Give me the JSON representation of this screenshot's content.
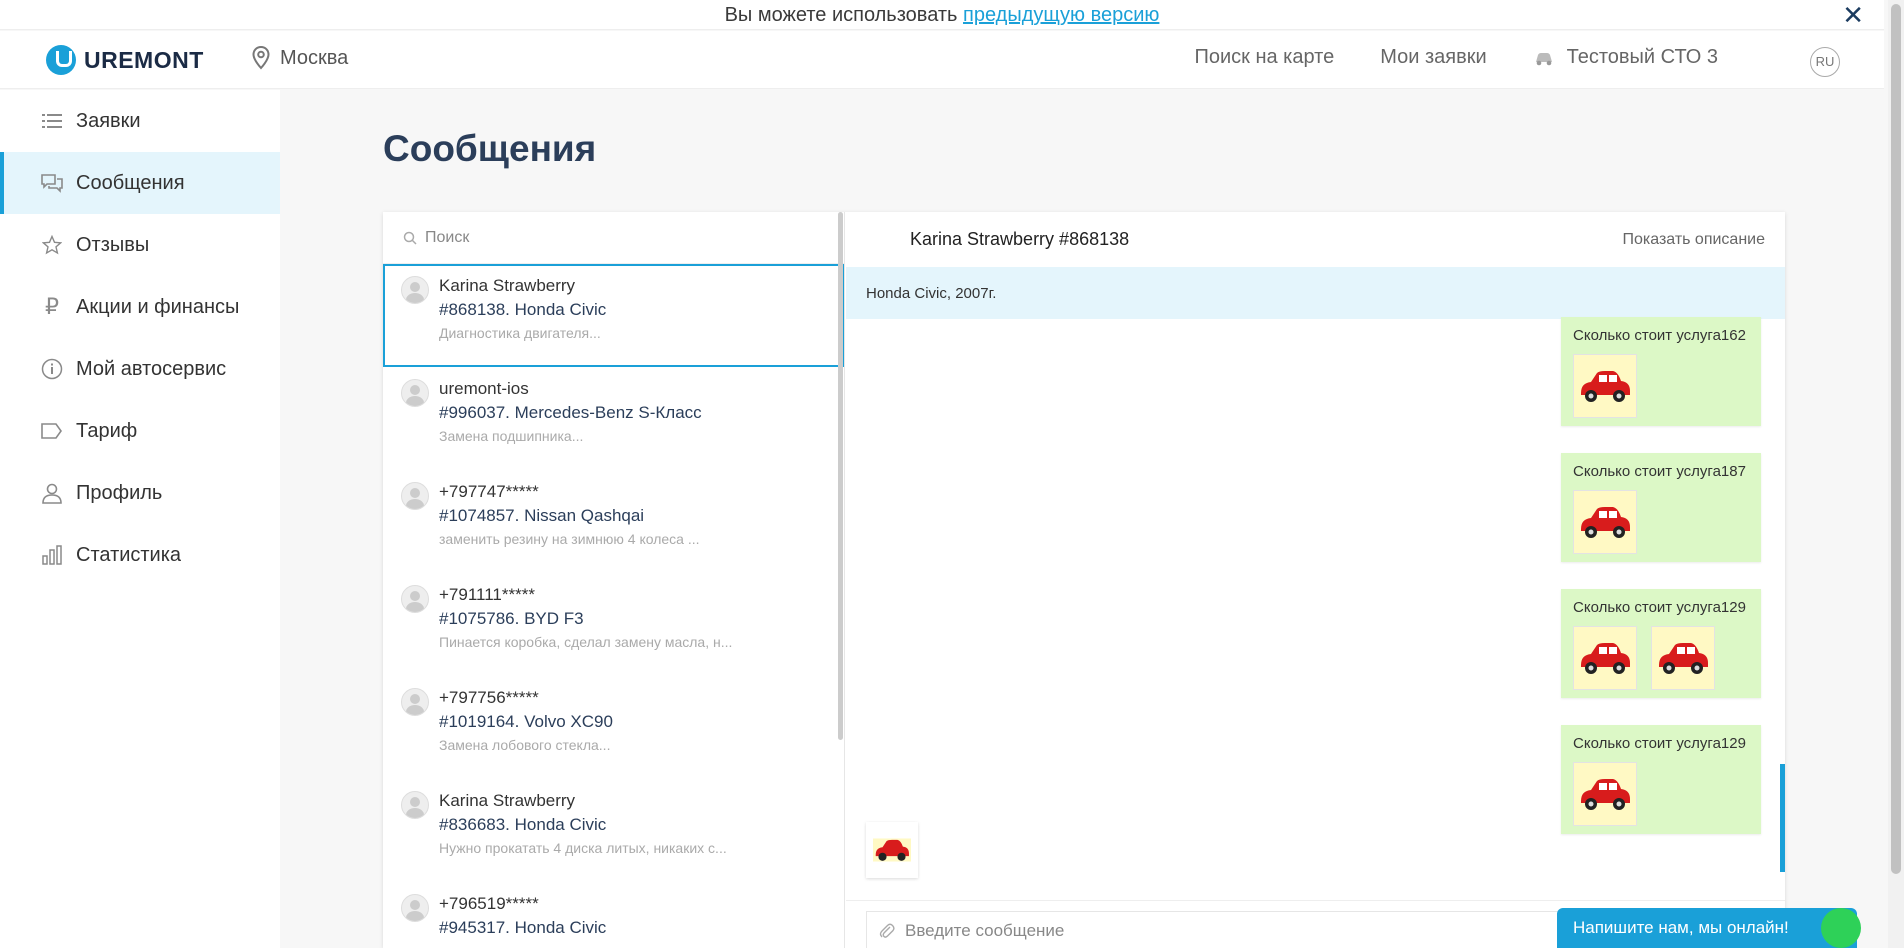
{
  "notice": {
    "text": "Вы можете использовать ",
    "link": "предыдущую версию",
    "close": "✕"
  },
  "header": {
    "logo": "UREMONT",
    "city": "Москва",
    "map_search": "Поиск на карте",
    "my_requests": "Мои заявки",
    "sto": "Тестовый СТО 3",
    "lang": "RU"
  },
  "sidebar": {
    "items": [
      {
        "label": "Заявки",
        "icon": "list-icon"
      },
      {
        "label": "Сообщения",
        "icon": "messages-icon"
      },
      {
        "label": "Отзывы",
        "icon": "star-icon"
      },
      {
        "label": "Акции и финансы",
        "icon": "ruble-icon"
      },
      {
        "label": "Мой автосервис",
        "icon": "info-icon"
      },
      {
        "label": "Тариф",
        "icon": "tag-icon"
      },
      {
        "label": "Профиль",
        "icon": "user-icon"
      },
      {
        "label": "Статистика",
        "icon": "chart-icon"
      }
    ]
  },
  "page_title": "Сообщения",
  "search_placeholder": "Поиск",
  "conversations": [
    {
      "name": "Karina Strawberry",
      "order": "#868138. Honda Civic",
      "desc": "Диагностика двигателя..."
    },
    {
      "name": "uremont-ios",
      "order": "#996037. Mercedes-Benz S-Класс",
      "desc": "Замена подшипника..."
    },
    {
      "name": "+797747*****",
      "order": "#1074857. Nissan Qashqai",
      "desc": "заменить резину на зимнюю  4 колеса ..."
    },
    {
      "name": "+791111*****",
      "order": "#1075786. BYD F3",
      "desc": "Пинается коробка, сделал замену масла, н..."
    },
    {
      "name": "+797756*****",
      "order": "#1019164. Volvo XC90",
      "desc": "Замена лобового стекла..."
    },
    {
      "name": "Karina Strawberry",
      "order": "#836683. Honda Civic",
      "desc": "Нужно прокатать 4 диска литых, никаких с..."
    },
    {
      "name": "+796519*****",
      "order": "#945317. Honda Civic",
      "desc": ""
    }
  ],
  "chat": {
    "title": "Karina Strawberry #868138",
    "show_desc": "Показать описание",
    "car": "Honda Civic, 2007г.",
    "messages": [
      {
        "text": "Сколько стоит услуга162",
        "images": 1
      },
      {
        "text": "Сколько стоит услуга187",
        "images": 1
      },
      {
        "text": "Сколько стоит услуга129",
        "images": 2
      },
      {
        "text": "Сколько стоит услуга129",
        "images": 1
      }
    ],
    "input_placeholder": "Введите сообщение"
  },
  "help_button": "Напишите нам, мы онлайн!"
}
